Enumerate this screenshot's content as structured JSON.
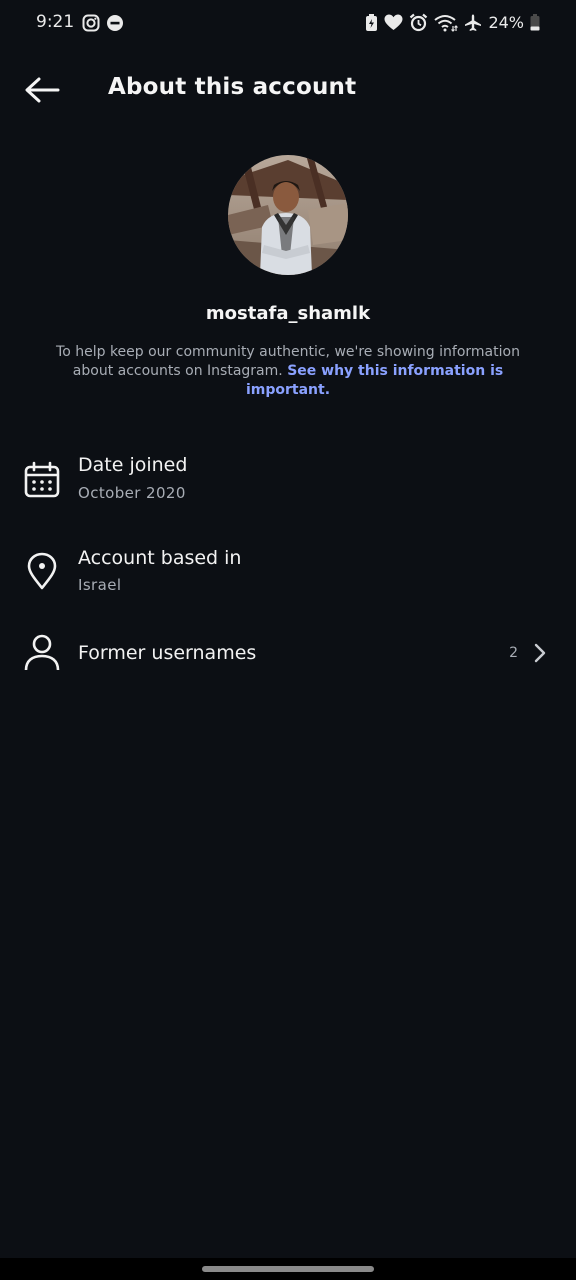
{
  "status_bar": {
    "time": "9:21",
    "battery": "24%",
    "left_icons": [
      "instagram-icon",
      "dnd-icon"
    ],
    "right_icons": [
      "battery-saver-icon",
      "heart-icon",
      "alarm-icon",
      "wifi-icon",
      "airplane-icon",
      "battery-icon"
    ]
  },
  "header": {
    "title": "About this account",
    "back_icon": "arrow-left-icon"
  },
  "profile": {
    "username": "mostafa_shamlk",
    "info_text": "To help keep our community authentic, we're showing information about accounts on Instagram.",
    "info_link": "See why this information is important."
  },
  "details": [
    {
      "icon": "calendar-icon",
      "title": "Date joined",
      "value": "October 2020"
    },
    {
      "icon": "location-pin-icon",
      "title": "Account based in",
      "value": "Israel"
    },
    {
      "icon": "person-icon",
      "title": "Former usernames",
      "count": "2",
      "chevron": "chevron-right-icon"
    }
  ],
  "colors": {
    "background": "#0c0f14",
    "link": "#8aa1ff",
    "secondary_text": "#a8adb5"
  }
}
